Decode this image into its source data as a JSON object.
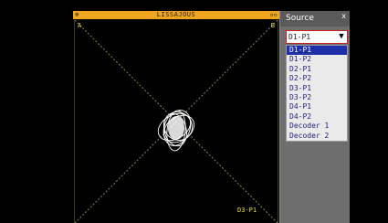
{
  "plot": {
    "title": "LISSAJOUS",
    "left_icon": "⊕",
    "right_icon": "▫▫",
    "corner_tl": "A",
    "corner_tr": "B",
    "trace_label": "D3-P1",
    "colors": {
      "titlebar": "#f0a51e",
      "axis": "#8a8650",
      "trace": "#ffffff",
      "label": "#e8e030"
    }
  },
  "source_panel": {
    "title": "Source",
    "close": "x",
    "selected_value": "D1-P1",
    "dropdown_icon": "chevron-down-icon",
    "options": [
      {
        "label": "D1-P1",
        "selected": true
      },
      {
        "label": "D1-P2",
        "selected": false
      },
      {
        "label": "D2-P1",
        "selected": false
      },
      {
        "label": "D2-P2",
        "selected": false
      },
      {
        "label": "D3-P1",
        "selected": false
      },
      {
        "label": "D3-P2",
        "selected": false
      },
      {
        "label": "D4-P1",
        "selected": false
      },
      {
        "label": "D4-P2",
        "selected": false
      },
      {
        "label": "Decoder 1",
        "selected": false
      },
      {
        "label": "Decoder 2",
        "selected": false
      }
    ]
  }
}
